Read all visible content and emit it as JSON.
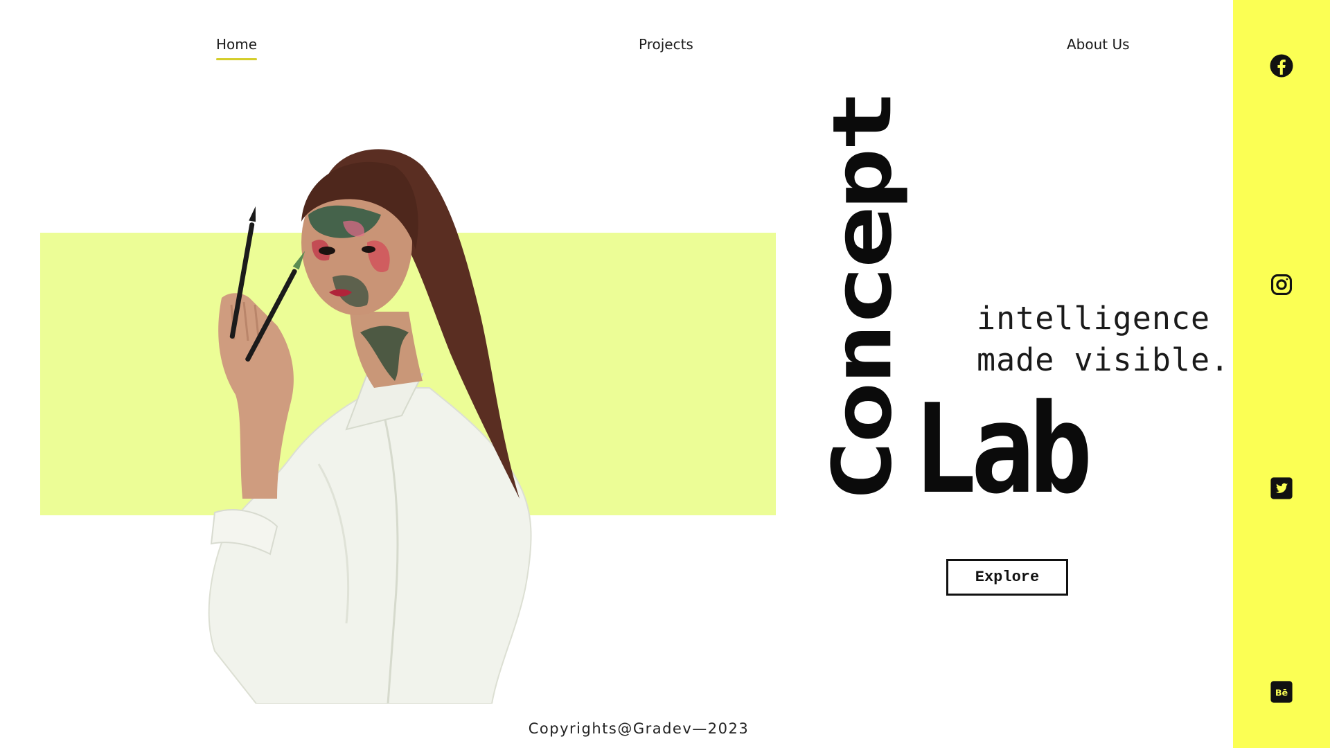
{
  "nav": {
    "items": [
      {
        "label": "Home",
        "active": true
      },
      {
        "label": "Projects",
        "active": false
      },
      {
        "label": "About Us",
        "active": false
      }
    ]
  },
  "sidebar": {
    "icons": [
      "facebook-icon",
      "instagram-icon",
      "twitter-icon",
      "behance-icon"
    ],
    "color": "#fbff54"
  },
  "hero": {
    "title_vertical": "Concept",
    "title_main": "Lab",
    "tagline_line1": "intelligence",
    "tagline_line2": "made visible.",
    "cta_label": "Explore",
    "band_color": "#ecfd96"
  },
  "footer": {
    "copyright": "Copyrights@Gradev—2023"
  },
  "colors": {
    "accent": "#d4cd2a",
    "text": "#111111",
    "background": "#ffffff"
  }
}
